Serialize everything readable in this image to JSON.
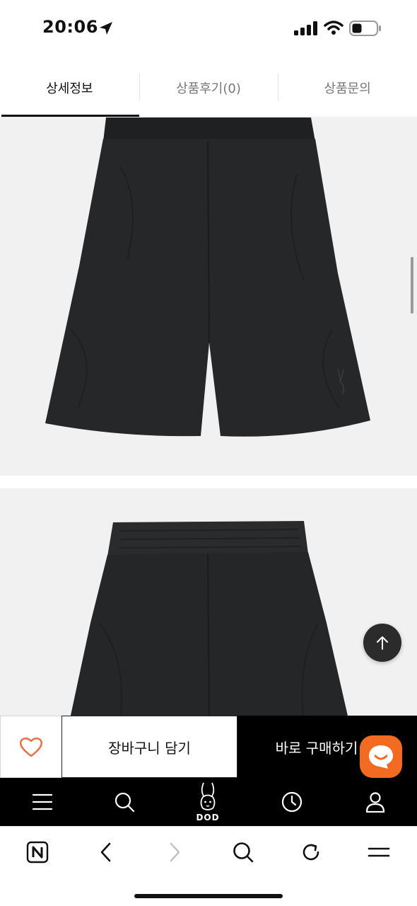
{
  "status_bar": {
    "time": "20:06"
  },
  "tabs": [
    {
      "label": "상세정보",
      "active": true
    },
    {
      "label": "상품후기(0)",
      "active": false
    },
    {
      "label": "상품문의",
      "active": false
    }
  ],
  "action_bar": {
    "cart_label": "장바구니 담기",
    "buy_label": "바로 구매하기"
  },
  "app_nav": {
    "logo_text": "DOD"
  },
  "colors": {
    "accent_orange": "#f36a21",
    "wish_heart": "#e8704a",
    "nav_bg": "#000000",
    "image_bg": "#f1f1f1"
  },
  "icons": {
    "status": [
      "location-arrow-icon",
      "signal-icon",
      "wifi-icon",
      "battery-icon"
    ],
    "app_nav": [
      "menu-icon",
      "search-icon",
      "dod-rabbit-logo",
      "recent-clock-icon",
      "account-icon"
    ],
    "browser": [
      "naver-n-icon",
      "back-icon",
      "forward-icon",
      "search-icon",
      "refresh-icon",
      "menu-icon"
    ]
  }
}
